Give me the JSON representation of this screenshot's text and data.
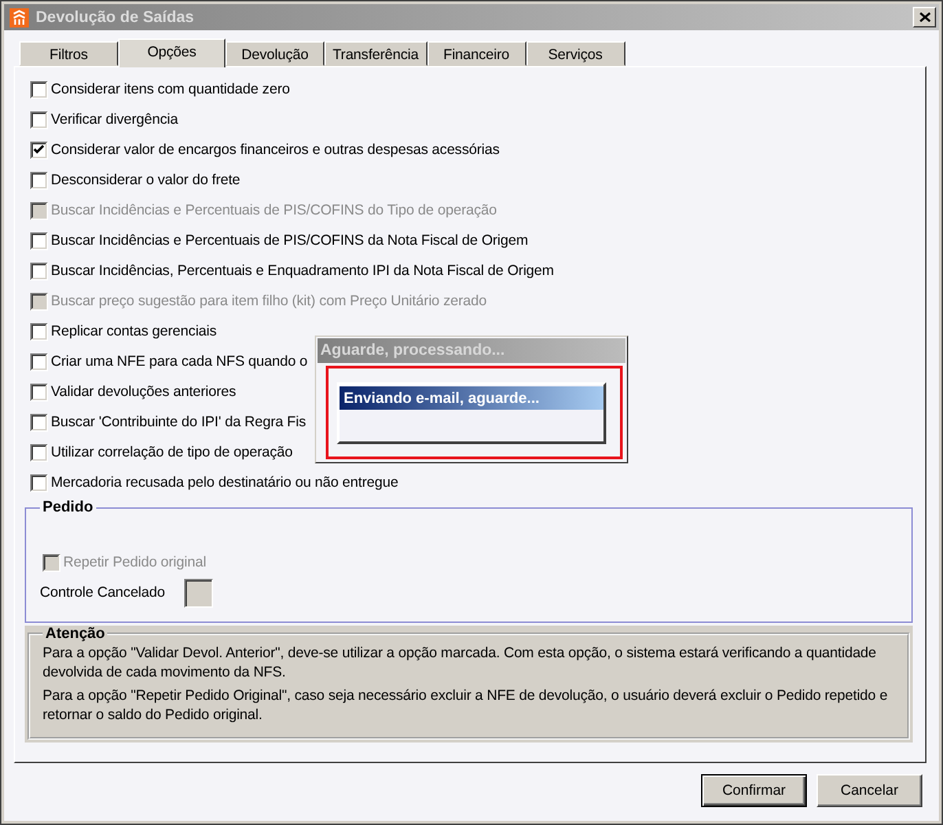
{
  "window": {
    "title": "Devolução de Saídas"
  },
  "tabs": [
    {
      "label": "Filtros",
      "selected": false
    },
    {
      "label": "Opções",
      "selected": true
    },
    {
      "label": "Devolução",
      "selected": false
    },
    {
      "label": "Transferência",
      "selected": false
    },
    {
      "label": "Financeiro",
      "selected": false
    },
    {
      "label": "Serviços",
      "selected": false
    }
  ],
  "options": [
    {
      "label": "Considerar itens com quantidade zero",
      "checked": false,
      "disabled": false
    },
    {
      "label": "Verificar divergência",
      "checked": false,
      "disabled": false
    },
    {
      "label": "Considerar valor de encargos financeiros e outras despesas acessórias",
      "checked": true,
      "disabled": false
    },
    {
      "label": "Desconsiderar o valor do frete",
      "checked": false,
      "disabled": false
    },
    {
      "label": "Buscar Incidências e Percentuais de PIS/COFINS do Tipo de operação",
      "checked": false,
      "disabled": true
    },
    {
      "label": "Buscar Incidências e Percentuais de PIS/COFINS da Nota Fiscal de Origem",
      "checked": false,
      "disabled": false
    },
    {
      "label": "Buscar Incidências, Percentuais e Enquadramento IPI da Nota Fiscal de Origem",
      "checked": false,
      "disabled": false
    },
    {
      "label": "Buscar preço sugestão para item filho (kit) com Preço Unitário zerado",
      "checked": false,
      "disabled": true
    },
    {
      "label": "Replicar contas gerenciais",
      "checked": false,
      "disabled": false
    },
    {
      "label": "Criar uma NFE para cada NFS quando o",
      "checked": false,
      "disabled": false
    },
    {
      "label": "Validar devoluções anteriores",
      "checked": false,
      "disabled": false
    },
    {
      "label": "Buscar 'Contribuinte do IPI' da Regra Fis",
      "checked": false,
      "disabled": false
    },
    {
      "label": "Utilizar correlação de tipo de operação",
      "checked": false,
      "disabled": false
    },
    {
      "label": "Mercadoria recusada pelo destinatário ou não entregue",
      "checked": false,
      "disabled": false
    }
  ],
  "order_group": {
    "title": "Pedido",
    "options": [
      {
        "label": "Repetir Pedido original",
        "checked": false,
        "disabled": true
      }
    ],
    "cancel_control": {
      "label": "Controle Cancelado"
    }
  },
  "notice": {
    "title": "Atenção",
    "paragraphs": [
      "Para a opção \"Validar Devol. Anterior\", deve-se utilizar a opção marcada. Com esta opção, o sistema estará verificando a quantidade devolvida de cada movimento da NFS.",
      "Para a opção \"Repetir Pedido Original\", caso seja necessário excluir a NFE de devolução, o usuário deverá excluir o Pedido repetido e retornar o saldo do Pedido original."
    ]
  },
  "buttons": [
    {
      "label": "Confirmar",
      "default": true
    },
    {
      "label": "Cancelar",
      "default": false
    }
  ],
  "progress_dialog": {
    "title": "Aguarde, processando...",
    "messages": [
      {
        "text": "Enviando e-mail, aguarde...",
        "selected": true
      }
    ]
  }
}
